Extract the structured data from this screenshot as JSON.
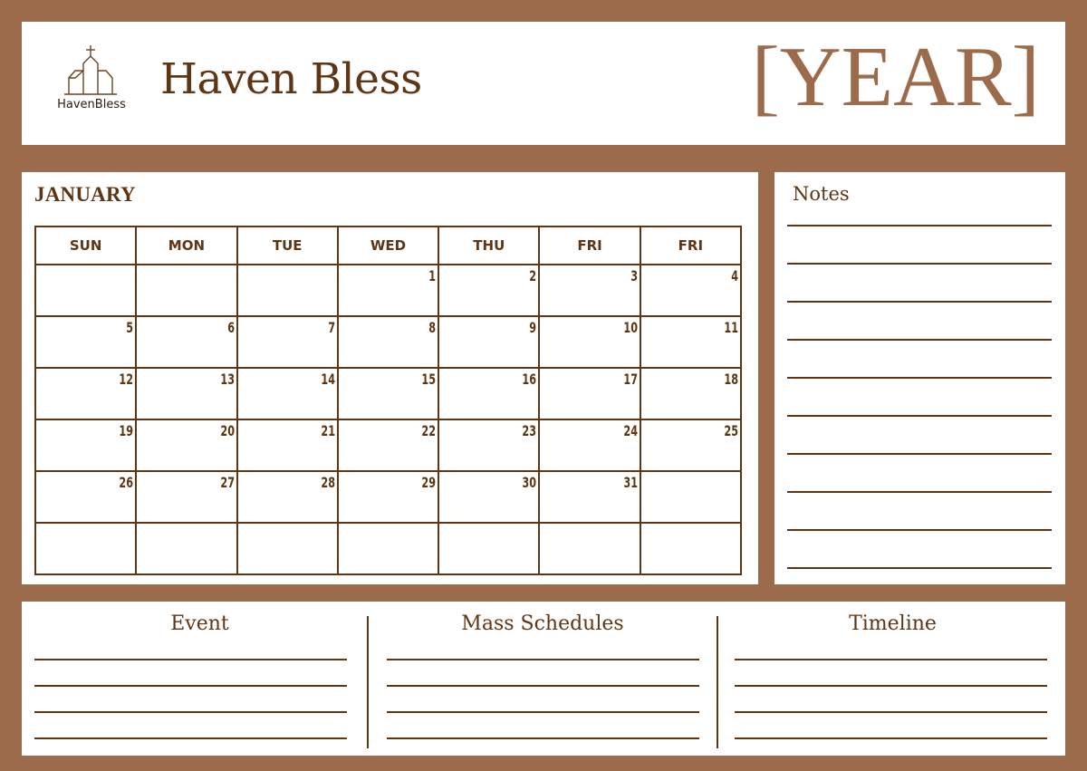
{
  "header": {
    "logo_text": "HavenBless",
    "brand": "Haven Bless",
    "year": "[YEAR]"
  },
  "calendar": {
    "month": "JANUARY",
    "weekdays": [
      "SUN",
      "MON",
      "TUE",
      "WED",
      "THU",
      "FRI",
      "FRI"
    ],
    "weeks": [
      [
        "",
        "",
        "",
        "1",
        "2",
        "3",
        "4"
      ],
      [
        "5",
        "6",
        "7",
        "8",
        "9",
        "10",
        "11"
      ],
      [
        "12",
        "13",
        "14",
        "15",
        "16",
        "17",
        "18"
      ],
      [
        "19",
        "20",
        "21",
        "22",
        "23",
        "24",
        "25"
      ],
      [
        "26",
        "27",
        "28",
        "29",
        "30",
        "31",
        ""
      ],
      [
        "",
        "",
        "",
        "",
        "",
        "",
        ""
      ]
    ]
  },
  "notes": {
    "title": "Notes",
    "line_count": 10
  },
  "bottom": {
    "sections": [
      {
        "title": "Event",
        "line_count": 4
      },
      {
        "title": "Mass Schedules",
        "line_count": 4
      },
      {
        "title": "Timeline",
        "line_count": 4
      }
    ]
  },
  "colors": {
    "background": "#9b6b4b",
    "text": "#5e3613",
    "year": "#9b6b4b",
    "panel": "#ffffff"
  }
}
